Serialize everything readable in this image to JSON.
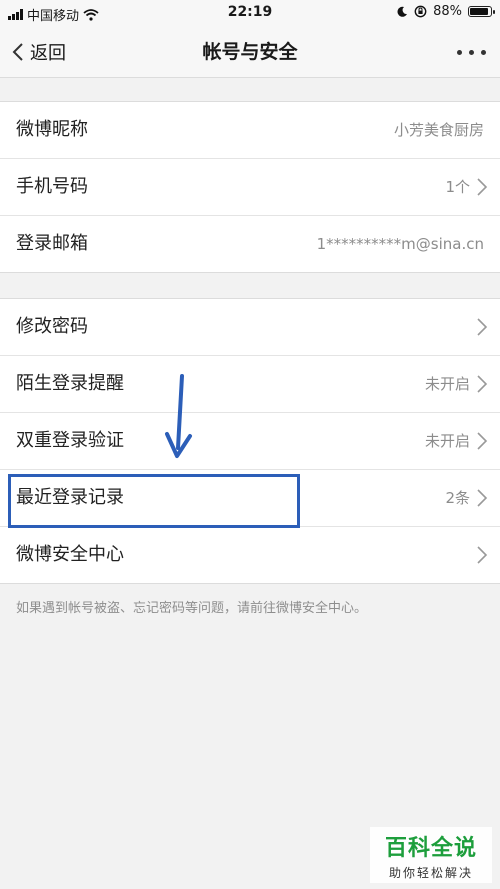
{
  "status": {
    "carrier": "中国移动",
    "time": "22:19",
    "battery": "88%",
    "battery_level": 0.88
  },
  "nav": {
    "back_label": "返回",
    "title": "帐号与安全"
  },
  "groups": [
    {
      "rows": [
        {
          "label": "微博昵称",
          "value": "小芳美食厨房"
        },
        {
          "label": "手机号码",
          "value": "1个"
        },
        {
          "label": "登录邮箱",
          "value": "1**********m@sina.cn"
        }
      ]
    },
    {
      "rows": [
        {
          "label": "修改密码",
          "value": ""
        },
        {
          "label": "陌生登录提醒",
          "value": "未开启"
        },
        {
          "label": "双重登录验证",
          "value": "未开启"
        },
        {
          "label": "最近登录记录",
          "value": "2条"
        },
        {
          "label": "微博安全中心",
          "value": ""
        }
      ]
    }
  ],
  "note": "如果遇到帐号被盗、忘记密码等问题，请前往微博安全中心。",
  "watermark": {
    "title": "百科全说",
    "subtitle": "助你轻松解决"
  },
  "colors": {
    "highlight": "#2c5eb8",
    "watermark_green": "#1d9e3c"
  }
}
